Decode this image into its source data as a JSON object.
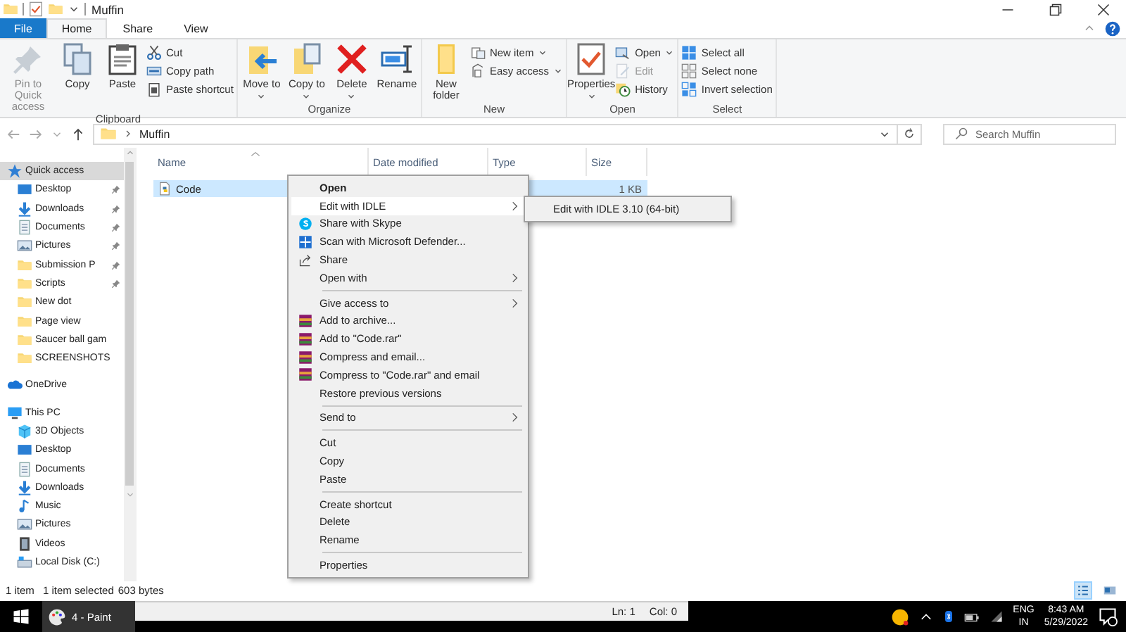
{
  "window": {
    "title": "Muffin"
  },
  "ribbon_tabs": [
    {
      "label": "File",
      "kind": "file",
      "selected": false
    },
    {
      "label": "Home",
      "kind": "tab",
      "selected": true
    },
    {
      "label": "Share",
      "kind": "tab",
      "selected": false
    },
    {
      "label": "View",
      "kind": "tab",
      "selected": false
    }
  ],
  "ribbon_groups": [
    {
      "label": "Clipboard",
      "buttons": [
        {
          "kind": "large",
          "label": "Pin to Quick access",
          "disabled": true,
          "dropdown": false
        },
        {
          "kind": "large",
          "label": "Copy",
          "disabled": false,
          "dropdown": false
        },
        {
          "kind": "large",
          "label": "Paste",
          "disabled": false,
          "dropdown": false
        },
        {
          "kind": "column",
          "items": [
            {
              "label": "Cut",
              "disabled": false,
              "dropdown": false
            },
            {
              "label": "Copy path",
              "disabled": false,
              "dropdown": false
            },
            {
              "label": "Paste shortcut",
              "disabled": false,
              "dropdown": false
            }
          ]
        }
      ]
    },
    {
      "label": "Organize",
      "buttons": [
        {
          "kind": "large",
          "label": "Move to",
          "disabled": false,
          "dropdown": true
        },
        {
          "kind": "large",
          "label": "Copy to",
          "disabled": false,
          "dropdown": true
        },
        {
          "kind": "large",
          "label": "Delete",
          "disabled": false,
          "dropdown": true
        },
        {
          "kind": "large",
          "label": "Rename",
          "disabled": false,
          "dropdown": false
        }
      ]
    },
    {
      "label": "New",
      "buttons": [
        {
          "kind": "large",
          "label": "New folder",
          "disabled": false,
          "dropdown": false
        },
        {
          "kind": "column",
          "items": [
            {
              "label": "New item",
              "disabled": false,
              "dropdown": true
            },
            {
              "label": "Easy access",
              "disabled": false,
              "dropdown": true
            }
          ]
        }
      ]
    },
    {
      "label": "Open",
      "buttons": [
        {
          "kind": "large",
          "label": "Properties",
          "disabled": false,
          "dropdown": true
        },
        {
          "kind": "column",
          "items": [
            {
              "label": "Open",
              "disabled": false,
              "dropdown": true
            },
            {
              "label": "Edit",
              "disabled": true,
              "dropdown": false
            },
            {
              "label": "History",
              "disabled": false,
              "dropdown": false
            }
          ]
        }
      ]
    },
    {
      "label": "Select",
      "buttons": [
        {
          "kind": "column",
          "items": [
            {
              "label": "Select all",
              "disabled": false,
              "dropdown": false
            },
            {
              "label": "Select none",
              "disabled": false,
              "dropdown": false
            },
            {
              "label": "Invert selection",
              "disabled": false,
              "dropdown": false
            }
          ]
        }
      ]
    }
  ],
  "address": {
    "path": [
      "Muffin"
    ]
  },
  "search": {
    "placeholder": "Search Muffin"
  },
  "sidebar": [
    {
      "label": "Quick access",
      "kind": "quick",
      "selected": true,
      "pinned": false,
      "children": [
        {
          "label": "Desktop",
          "kind": "desktop",
          "selected": false,
          "pinned": true
        },
        {
          "label": "Downloads",
          "kind": "downloads",
          "selected": false,
          "pinned": true
        },
        {
          "label": "Documents",
          "kind": "documents",
          "selected": false,
          "pinned": true
        },
        {
          "label": "Pictures",
          "kind": "pictures",
          "selected": false,
          "pinned": true
        },
        {
          "label": "Submission P",
          "kind": "folder",
          "selected": false,
          "pinned": true
        },
        {
          "label": "Scripts",
          "kind": "folder",
          "selected": false,
          "pinned": true
        },
        {
          "label": "New dot",
          "kind": "folder",
          "selected": false,
          "pinned": false
        },
        {
          "label": "Page view",
          "kind": "folder",
          "selected": false,
          "pinned": false
        },
        {
          "label": "Saucer ball gam",
          "kind": "folder",
          "selected": false,
          "pinned": false
        },
        {
          "label": "SCREENSHOTS",
          "kind": "folder",
          "selected": false,
          "pinned": false
        }
      ]
    },
    {
      "label": "OneDrive",
      "kind": "cloud",
      "selected": false,
      "pinned": false
    },
    {
      "label": "This PC",
      "kind": "pc",
      "selected": false,
      "pinned": false,
      "children": [
        {
          "label": "3D Objects",
          "kind": "objects",
          "selected": false,
          "pinned": false
        },
        {
          "label": "Desktop",
          "kind": "desktop",
          "selected": false,
          "pinned": false
        },
        {
          "label": "Documents",
          "kind": "documents",
          "selected": false,
          "pinned": false
        },
        {
          "label": "Downloads",
          "kind": "downloads",
          "selected": false,
          "pinned": false
        },
        {
          "label": "Music",
          "kind": "music",
          "selected": false,
          "pinned": false
        },
        {
          "label": "Pictures",
          "kind": "pictures",
          "selected": false,
          "pinned": false
        },
        {
          "label": "Videos",
          "kind": "videos",
          "selected": false,
          "pinned": false
        },
        {
          "label": "Local Disk (C:)",
          "kind": "disk",
          "selected": false,
          "pinned": false
        }
      ]
    }
  ],
  "columns": [
    {
      "label": "Name",
      "sorted": true
    },
    {
      "label": "Date modified",
      "sorted": false
    },
    {
      "label": "Type",
      "sorted": false
    },
    {
      "label": "Size",
      "sorted": false
    }
  ],
  "files": [
    {
      "name": "Code",
      "size": "1 KB",
      "selected": true
    }
  ],
  "context_menu": [
    {
      "kind": "item",
      "label": "Open",
      "default": true,
      "selected": false,
      "submenu": false
    },
    {
      "kind": "item",
      "label": "Edit with IDLE",
      "default": false,
      "selected": true,
      "submenu": true
    },
    {
      "kind": "item",
      "label": "Share with Skype",
      "default": false,
      "selected": false,
      "submenu": false
    },
    {
      "kind": "item",
      "label": "Scan with Microsoft Defender...",
      "default": false,
      "selected": false,
      "submenu": false
    },
    {
      "kind": "item",
      "label": "Share",
      "default": false,
      "selected": false,
      "submenu": false
    },
    {
      "kind": "item",
      "label": "Open with",
      "default": false,
      "selected": false,
      "submenu": true
    },
    {
      "kind": "separator"
    },
    {
      "kind": "item",
      "label": "Give access to",
      "default": false,
      "selected": false,
      "submenu": true
    },
    {
      "kind": "item",
      "label": "Add to archive...",
      "default": false,
      "selected": false,
      "submenu": false
    },
    {
      "kind": "item",
      "label": "Add to \"Code.rar\"",
      "default": false,
      "selected": false,
      "submenu": false
    },
    {
      "kind": "item",
      "label": "Compress and email...",
      "default": false,
      "selected": false,
      "submenu": false
    },
    {
      "kind": "item",
      "label": "Compress to \"Code.rar\" and email",
      "default": false,
      "selected": false,
      "submenu": false
    },
    {
      "kind": "item",
      "label": "Restore previous versions",
      "default": false,
      "selected": false,
      "submenu": false
    },
    {
      "kind": "separator"
    },
    {
      "kind": "item",
      "label": "Send to",
      "default": false,
      "selected": false,
      "submenu": true
    },
    {
      "kind": "separator"
    },
    {
      "kind": "item",
      "label": "Cut",
      "default": false,
      "selected": false,
      "submenu": false
    },
    {
      "kind": "item",
      "label": "Copy",
      "default": false,
      "selected": false,
      "submenu": false
    },
    {
      "kind": "item",
      "label": "Paste",
      "default": false,
      "selected": false,
      "submenu": false
    },
    {
      "kind": "separator"
    },
    {
      "kind": "item",
      "label": "Create shortcut",
      "default": false,
      "selected": false,
      "submenu": false
    },
    {
      "kind": "item",
      "label": "Delete",
      "default": false,
      "selected": false,
      "submenu": false
    },
    {
      "kind": "item",
      "label": "Rename",
      "default": false,
      "selected": false,
      "submenu": false
    },
    {
      "kind": "separator"
    },
    {
      "kind": "item",
      "label": "Properties",
      "default": false,
      "selected": false,
      "submenu": false
    }
  ],
  "submenu": [
    {
      "label": "Edit with IDLE 3.10 (64-bit)"
    }
  ],
  "status_bar": {
    "item_count": "1 item",
    "selection": "1 item selected",
    "size": "603 bytes"
  },
  "view_buttons": [
    {
      "kind": "details",
      "selected": true
    },
    {
      "kind": "tiles",
      "selected": false
    }
  ],
  "background_window": {
    "line": "Ln: 1",
    "column": "Col: 0"
  },
  "taskbar": {
    "apps": [
      {
        "label": "4 - Paint",
        "selected": true
      }
    ],
    "language": "ENG",
    "region": "IN",
    "time": "8:43 AM",
    "date": "5/29/2022"
  }
}
